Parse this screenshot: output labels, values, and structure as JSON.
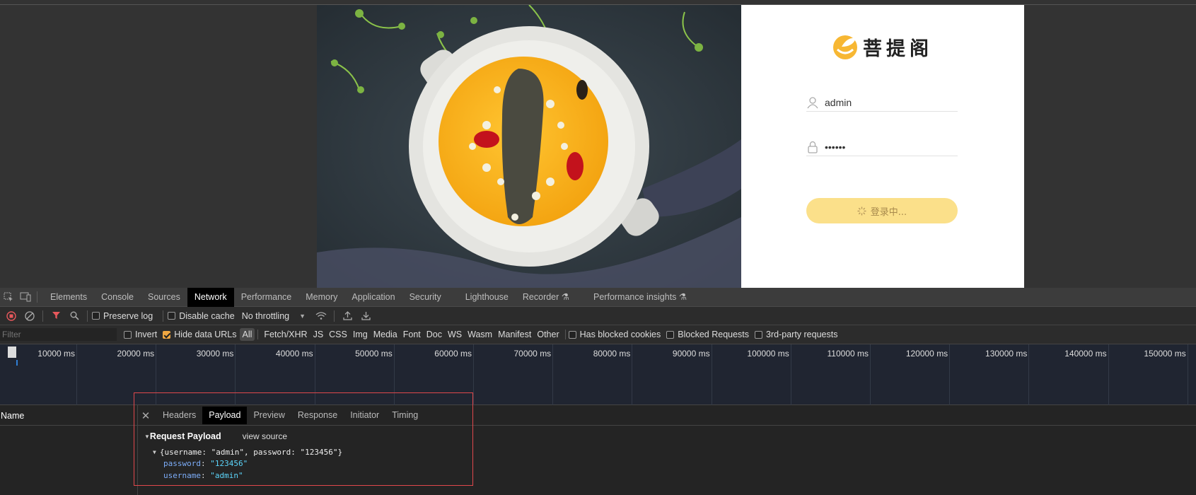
{
  "login": {
    "brand": "菩提阁",
    "username": "admin",
    "password": "••••••",
    "button_label": "登录中..."
  },
  "devtools": {
    "tabs": [
      "Elements",
      "Console",
      "Sources",
      "Network",
      "Performance",
      "Memory",
      "Application",
      "Security",
      "Lighthouse",
      "Recorder",
      "Performance insights"
    ],
    "active_tab": "Network",
    "toolbar": {
      "preserve_log": "Preserve log",
      "disable_cache": "Disable cache",
      "throttling": "No throttling"
    },
    "filter": {
      "placeholder": "Filter",
      "invert": "Invert",
      "hide_data_urls": "Hide data URLs",
      "types": [
        "All",
        "Fetch/XHR",
        "JS",
        "CSS",
        "Img",
        "Media",
        "Font",
        "Doc",
        "WS",
        "Wasm",
        "Manifest",
        "Other"
      ],
      "has_blocked_cookies": "Has blocked cookies",
      "blocked_requests": "Blocked Requests",
      "third_party": "3rd-party requests"
    },
    "timeline_ticks": [
      "10000 ms",
      "20000 ms",
      "30000 ms",
      "40000 ms",
      "50000 ms",
      "60000 ms",
      "70000 ms",
      "80000 ms",
      "90000 ms",
      "100000 ms",
      "110000 ms",
      "120000 ms",
      "130000 ms",
      "140000 ms",
      "150000 ms"
    ],
    "name_column": "Name",
    "detail_tabs": [
      "Headers",
      "Payload",
      "Preview",
      "Response",
      "Initiator",
      "Timing"
    ],
    "active_detail_tab": "Payload",
    "payload": {
      "title": "Request Payload",
      "view_source": "view source",
      "summary": "{username: \"admin\", password: \"123456\"}",
      "props": [
        {
          "key": "password",
          "value": "\"123456\""
        },
        {
          "key": "username",
          "value": "\"admin\""
        }
      ]
    }
  }
}
